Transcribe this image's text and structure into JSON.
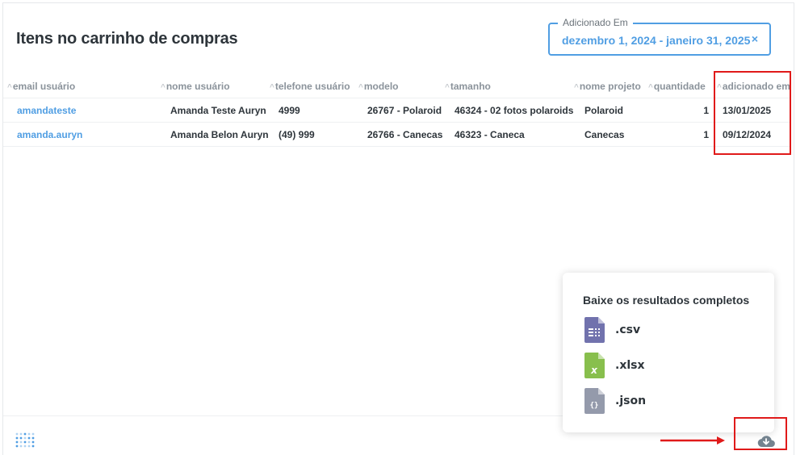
{
  "page": {
    "title": "Itens no carrinho de compras"
  },
  "filter": {
    "legend": "Adicionado Em",
    "value": "dezembro 1, 2024 - janeiro 31, 2025",
    "clear_icon": "×"
  },
  "table": {
    "columns": [
      {
        "label": "email usuário"
      },
      {
        "label": "nome usuário"
      },
      {
        "label": "telefone usuário"
      },
      {
        "label": "modelo"
      },
      {
        "label": "tamanho"
      },
      {
        "label": "nome projeto"
      },
      {
        "label": "quantidade"
      },
      {
        "label": "adicionado em"
      }
    ],
    "rows": [
      [
        "amandateste",
        "Amanda Teste Auryn",
        "4999",
        "26767 - Polaroid",
        "46324 - 02 fotos polaroids",
        "Polaroid",
        "1",
        "13/01/2025"
      ],
      [
        "amanda.auryn",
        "Amanda Belon Auryn",
        "(49) 999",
        "26766 - Canecas",
        "46323 - Caneca",
        "Canecas",
        "1",
        "09/12/2024"
      ]
    ]
  },
  "download": {
    "title": "Baixe os resultados completos",
    "formats": [
      {
        "label": ".csv",
        "icon": "csv-file-icon",
        "color": "#7172ad"
      },
      {
        "label": ".xlsx",
        "icon": "xlsx-file-icon",
        "color": "#88bf4d"
      },
      {
        "label": ".json",
        "icon": "json-file-icon",
        "color": "#949aab"
      }
    ],
    "button_icon": "download-cloud-icon"
  },
  "colors": {
    "accent": "#509ee3",
    "highlight": "#e01a1a",
    "text": "#2e353b",
    "header_text": "#8b939b"
  }
}
